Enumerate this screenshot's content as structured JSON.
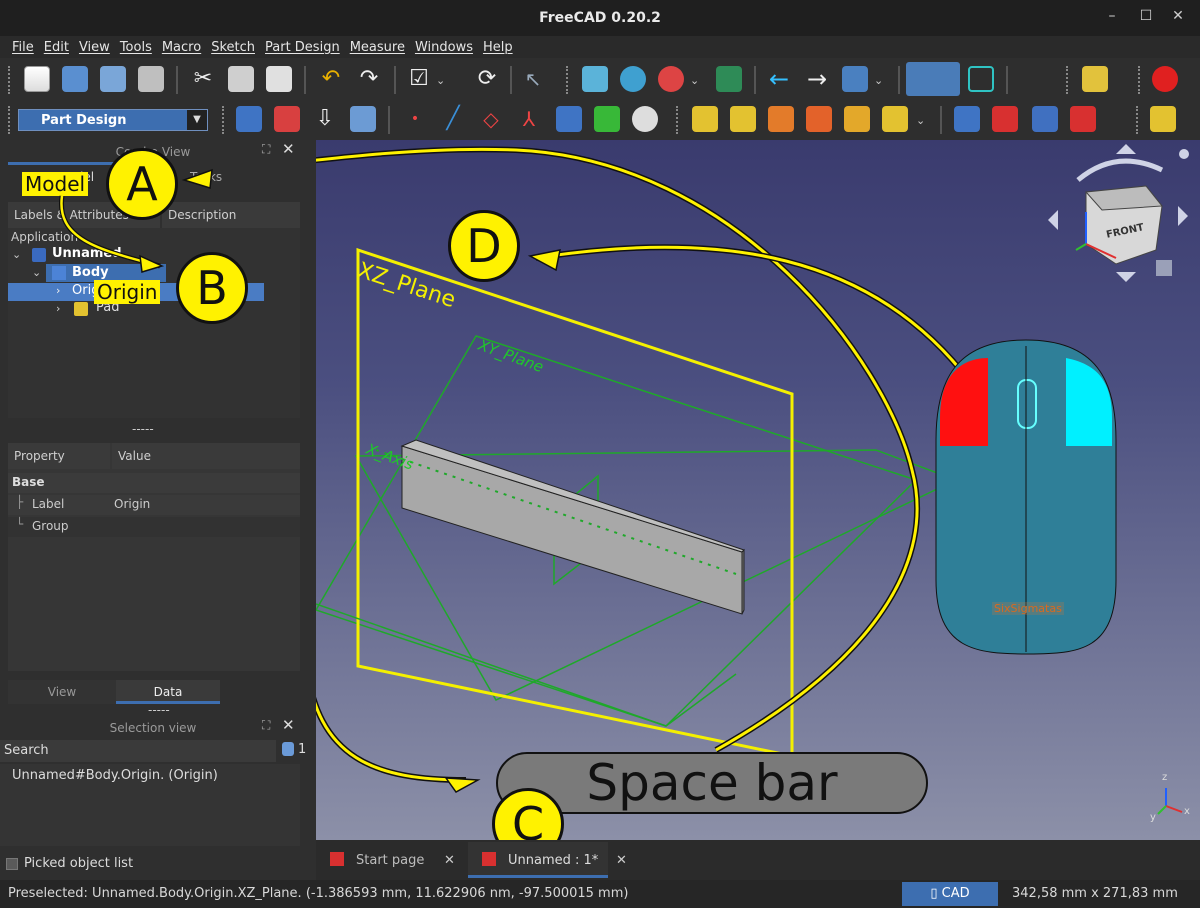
{
  "window": {
    "title": "FreeCAD 0.20.2",
    "controls": [
      "–",
      "☐",
      "✕"
    ]
  },
  "menu": [
    "File",
    "Edit",
    "View",
    "Tools",
    "Macro",
    "Sketch",
    "Part Design",
    "Measure",
    "Windows",
    "Help"
  ],
  "workbench": {
    "selected": "Part Design"
  },
  "combo_view": {
    "title": "Combo View",
    "tab_model": "Model",
    "tab_tasks": "Tasks",
    "col_labels": "Labels & Attributes",
    "col_description": "Description",
    "application": "Application",
    "tree": [
      {
        "label": "Unnamed",
        "level": 0
      },
      {
        "label": "Body",
        "level": 1
      },
      {
        "label": "Origin",
        "level": 2
      },
      {
        "label": "Pad",
        "level": 2
      }
    ],
    "splitter": "-----"
  },
  "property_view": {
    "col_property": "Property",
    "col_value": "Value",
    "group": "Base",
    "rows": [
      {
        "name": "Label",
        "value": "Origin"
      },
      {
        "name": "Group",
        "value": ""
      }
    ],
    "tab_view": "View",
    "tab_data": "Data",
    "splitter": "-----"
  },
  "selection_view": {
    "title": "Selection view",
    "search_placeholder": "Search",
    "count": "1",
    "item": "Unnamed#Body.Origin. (Origin)",
    "picked_list": "Picked object list"
  },
  "viewport": {
    "planes": {
      "xz": "XZ_Plane",
      "xy": "XY_Plane",
      "x_axis": "X_Axis"
    },
    "navcube_face": "FRONT",
    "mouse_brand": "SixSigmatas",
    "axis_labels": {
      "x": "x",
      "y": "y",
      "z": "z"
    }
  },
  "annotations": {
    "a": "A",
    "b": "B",
    "c": "C",
    "d": "D",
    "model_label": "Model",
    "origin_label": "Origin",
    "space_bar": "Space bar"
  },
  "tabs": [
    {
      "label": "Start page"
    },
    {
      "label": "Unnamed : 1*"
    }
  ],
  "status": {
    "preselected": "Preselected: Unnamed.Body.Origin.XZ_Plane. (-1.386593 mm, 11.622906 nm, -97.500015 mm)",
    "nav_style": "CAD",
    "dimensions": "342,58 mm x 271,83 mm"
  },
  "colors": {
    "accent_blue": "#3d6eb0",
    "callout_yellow": "#fff200",
    "plane_yellow": "#f4f000",
    "plane_green": "#1fa82a",
    "record_red": "#e02020"
  }
}
